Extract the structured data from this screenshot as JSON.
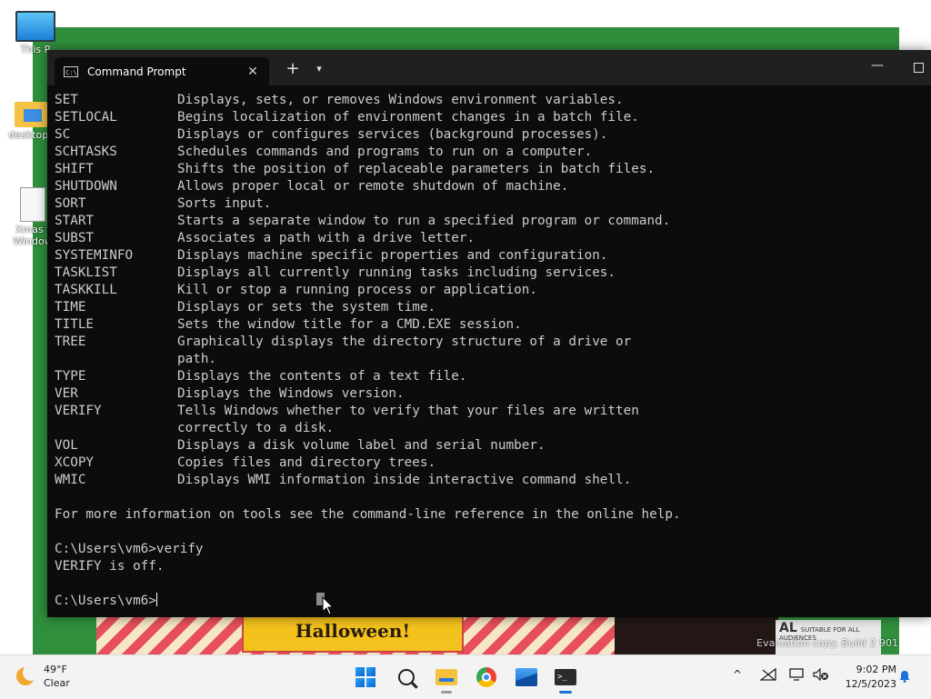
{
  "desktop": {
    "icons": [
      {
        "label": "This P"
      },
      {
        "label": "desktop_"
      },
      {
        "label": "Xmas f Window"
      }
    ],
    "wallpaper": {
      "poster_text": "Halloween!",
      "rating_badge": "SUITABLE FOR ALL AUDIENCES",
      "rating_code": "AL"
    },
    "watermark": "Evaluation copy. Build 2  901"
  },
  "window": {
    "tab_title": "Command Prompt",
    "tab_icon_text": "C:\\",
    "new_tab_glyph": "+",
    "dropdown_glyph": "⌵",
    "minimize_glyph": "—"
  },
  "console": {
    "commands": [
      {
        "cmd": "SET",
        "desc": "Displays, sets, or removes Windows environment variables."
      },
      {
        "cmd": "SETLOCAL",
        "desc": "Begins localization of environment changes in a batch file."
      },
      {
        "cmd": "SC",
        "desc": "Displays or configures services (background processes)."
      },
      {
        "cmd": "SCHTASKS",
        "desc": "Schedules commands and programs to run on a computer."
      },
      {
        "cmd": "SHIFT",
        "desc": "Shifts the position of replaceable parameters in batch files."
      },
      {
        "cmd": "SHUTDOWN",
        "desc": "Allows proper local or remote shutdown of machine."
      },
      {
        "cmd": "SORT",
        "desc": "Sorts input."
      },
      {
        "cmd": "START",
        "desc": "Starts a separate window to run a specified program or command."
      },
      {
        "cmd": "SUBST",
        "desc": "Associates a path with a drive letter."
      },
      {
        "cmd": "SYSTEMINFO",
        "desc": "Displays machine specific properties and configuration."
      },
      {
        "cmd": "TASKLIST",
        "desc": "Displays all currently running tasks including services."
      },
      {
        "cmd": "TASKKILL",
        "desc": "Kill or stop a running process or application."
      },
      {
        "cmd": "TIME",
        "desc": "Displays or sets the system time."
      },
      {
        "cmd": "TITLE",
        "desc": "Sets the window title for a CMD.EXE session."
      },
      {
        "cmd": "TREE",
        "desc": "Graphically displays the directory structure of a drive or"
      },
      {
        "cmd": "",
        "desc": "path."
      },
      {
        "cmd": "TYPE",
        "desc": "Displays the contents of a text file."
      },
      {
        "cmd": "VER",
        "desc": "Displays the Windows version."
      },
      {
        "cmd": "VERIFY",
        "desc": "Tells Windows whether to verify that your files are written"
      },
      {
        "cmd": "",
        "desc": "correctly to a disk."
      },
      {
        "cmd": "VOL",
        "desc": "Displays a disk volume label and serial number."
      },
      {
        "cmd": "XCOPY",
        "desc": "Copies files and directory trees."
      },
      {
        "cmd": "WMIC",
        "desc": "Displays WMI information inside interactive command shell."
      }
    ],
    "footer_info": "For more information on tools see the command-line reference in the online help.",
    "prompt_command": "C:\\Users\\vm6>verify",
    "output": "VERIFY is off.",
    "current_prompt": "C:\\Users\\vm6>"
  },
  "taskbar": {
    "weather": {
      "temp": "49°F",
      "condition": "Clear"
    },
    "apps": [
      "start-icon",
      "search-icon",
      "file-explorer-icon",
      "chrome-icon",
      "photos-icon",
      "terminal-icon"
    ],
    "tray": {
      "chevron": "^"
    },
    "clock": {
      "time": "9:02 PM",
      "date": "12/5/2023"
    }
  }
}
